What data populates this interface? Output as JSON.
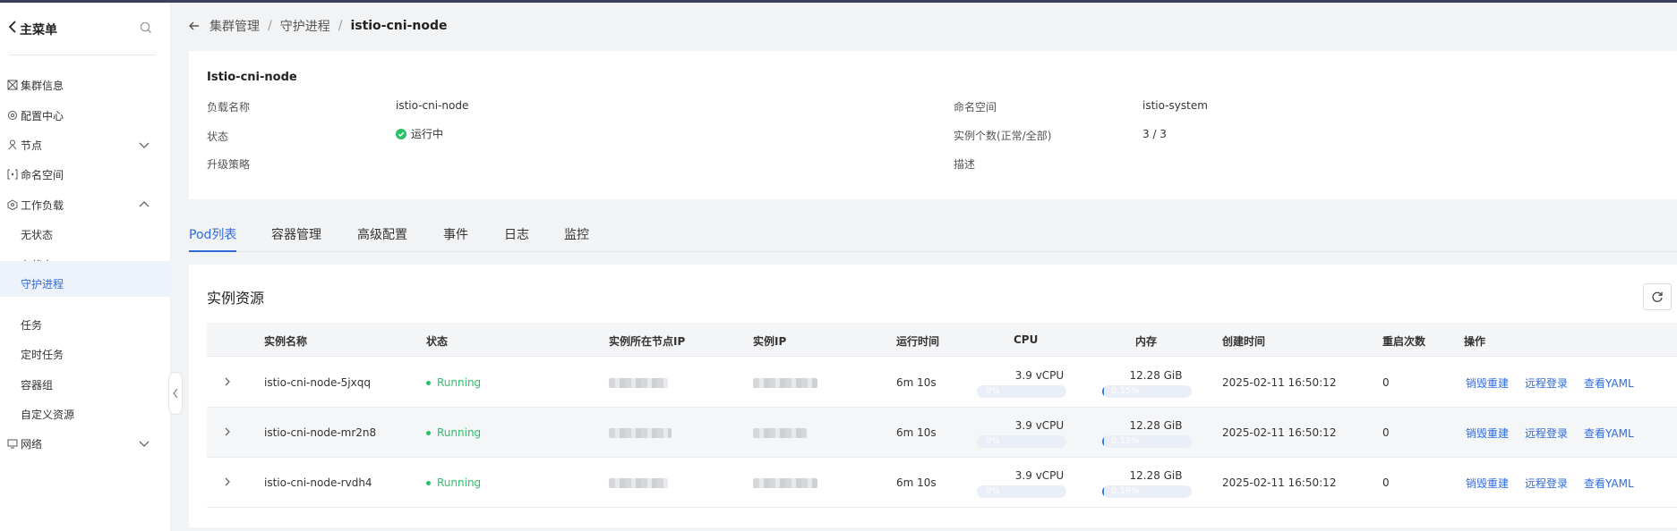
{
  "sidebar": {
    "title": "主菜单",
    "items": [
      {
        "label": "集群信息",
        "icon": "cluster-info-icon"
      },
      {
        "label": "配置中心",
        "icon": "config-center-icon"
      },
      {
        "label": "节点",
        "icon": "node-icon",
        "expandable": true
      },
      {
        "label": "命名空间",
        "icon": "namespace-icon"
      },
      {
        "label": "工作负载",
        "icon": "workload-icon",
        "expandable": true,
        "expanded": true
      }
    ],
    "workload_children": [
      "无状态",
      "有状态",
      "守护进程",
      "任务",
      "定时任务",
      "容器组",
      "自定义资源"
    ],
    "active_child": "守护进程",
    "network": {
      "label": "网络",
      "icon": "network-icon"
    }
  },
  "breadcrumb": {
    "items": [
      "集群管理",
      "守护进程"
    ],
    "separator": "/",
    "current": "istio-cni-node"
  },
  "info": {
    "title": "Istio-cni-node",
    "workload_name_label": "负载名称",
    "workload_name": "istio-cni-node",
    "status_label": "状态",
    "status": "运行中",
    "upgrade_label": "升级策略",
    "namespace_label": "命名空间",
    "namespace": "istio-system",
    "instances_label": "实例个数(正常/全部)",
    "instances": "3 / 3",
    "description_label": "描述"
  },
  "tabs": [
    "Pod列表",
    "容器管理",
    "高级配置",
    "事件",
    "日志",
    "监控"
  ],
  "active_tab": "Pod列表",
  "panel": {
    "title": "实例资源",
    "columns": [
      "实例名称",
      "状态",
      "实例所在节点IP",
      "实例IP",
      "运行时间",
      "CPU",
      "内存",
      "创建时间",
      "重启次数",
      "操作"
    ],
    "actions": [
      "销毁重建",
      "远程登录",
      "查看YAML"
    ],
    "rows": [
      {
        "name": "istio-cni-node-5jxqq",
        "status": "Running",
        "uptime": "6m 10s",
        "cpu": "3.9 vCPU",
        "cpu_pct": "0%",
        "cpu_frac": 0.0,
        "mem": "12.28 GiB",
        "mem_pct": "0.15%",
        "mem_frac": 0.015,
        "created": "2025-02-11 16:50:12",
        "restarts": "0"
      },
      {
        "name": "istio-cni-node-mr2n8",
        "status": "Running",
        "uptime": "6m 10s",
        "cpu": "3.9 vCPU",
        "cpu_pct": "0%",
        "cpu_frac": 0.0,
        "mem": "12.28 GiB",
        "mem_pct": "0.12%",
        "mem_frac": 0.012,
        "created": "2025-02-11 16:50:12",
        "restarts": "0"
      },
      {
        "name": "istio-cni-node-rvdh4",
        "status": "Running",
        "uptime": "6m 10s",
        "cpu": "3.9 vCPU",
        "cpu_pct": "0%",
        "cpu_frac": 0.0,
        "mem": "12.28 GiB",
        "mem_pct": "0.19%",
        "mem_frac": 0.019,
        "created": "2025-02-11 16:50:12",
        "restarts": "0"
      }
    ]
  },
  "colors": {
    "accent": "#2f6bdc",
    "running": "#2bbf6a"
  }
}
